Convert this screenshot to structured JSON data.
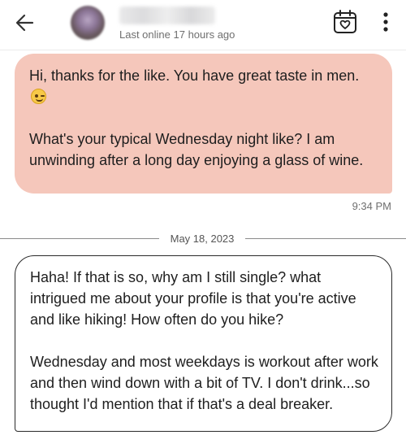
{
  "header": {
    "last_online": "Last online 17 hours ago",
    "back_icon": "arrow-left-icon",
    "calendar_icon": "calendar-heart-icon",
    "more_icon": "more-vertical-icon"
  },
  "messages": [
    {
      "text": "Hi, thanks for the like. You have great taste in men.",
      "emoji": "winking-face-emoji",
      "text_continued": "What's your typical Wednesday night like? I am unwinding after a long day enjoying a glass of wine.",
      "time": "9:34 PM",
      "color": "#f5c7bb"
    },
    {
      "text": "Haha! If that is so, why am I still single?  what intrigued me about your profile is that you're active and like hiking!  How often do you hike?\n\nWednesday and most weekdays is workout after work and then wind down with a bit of TV.  I don't drink...so thought I'd mention that if that's a deal breaker."
    }
  ],
  "date_separator": "May 18, 2023"
}
